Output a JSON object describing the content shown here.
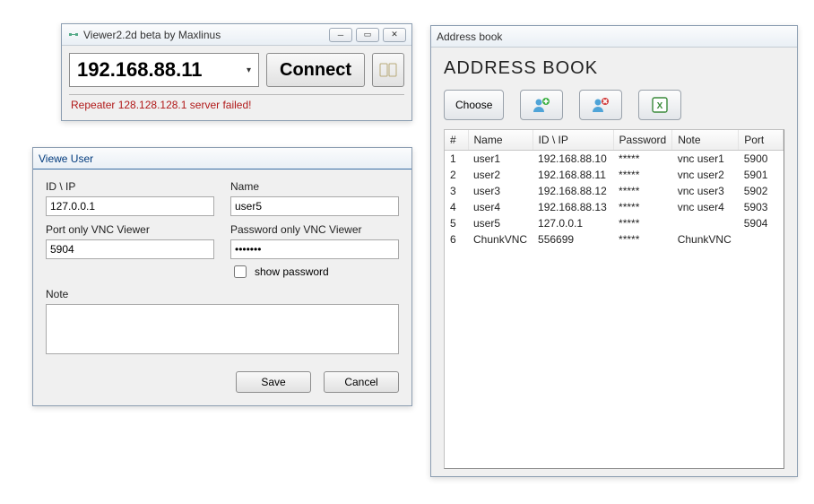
{
  "viewer": {
    "title": "Viewer2.2d beta by Maxlinus",
    "ip_value": "192.168.88.11",
    "connect_label": "Connect",
    "status": "Repeater 128.128.128.1 server failed!"
  },
  "user_form": {
    "title": "Viewe User",
    "labels": {
      "id_ip": "ID \\ IP",
      "name": "Name",
      "port": "Port only VNC Viewer",
      "password": "Password only VNC Viewer",
      "show_password": "show password",
      "note": "Note"
    },
    "values": {
      "id_ip": "127.0.0.1",
      "name": "user5",
      "port": "5904",
      "password": "•••••••",
      "note": ""
    },
    "buttons": {
      "save": "Save",
      "cancel": "Cancel"
    }
  },
  "book": {
    "title_small": "Address book",
    "title_big": "ADDRESS BOOK",
    "choose_label": "Choose",
    "columns": [
      "#",
      "Name",
      "ID \\ IP",
      "Password",
      "Note",
      "Port"
    ],
    "rows": [
      [
        "1",
        "user1",
        "192.168.88.10",
        "*****",
        "vnc user1",
        "5900"
      ],
      [
        "2",
        "user2",
        "192.168.88.11",
        "*****",
        "vnc user2",
        "5901"
      ],
      [
        "3",
        "user3",
        "192.168.88.12",
        "*****",
        "vnc user3",
        "5902"
      ],
      [
        "4",
        "user4",
        "192.168.88.13",
        "*****",
        "vnc user4",
        "5903"
      ],
      [
        "5",
        "user5",
        "127.0.0.1",
        "*****",
        "",
        "5904"
      ],
      [
        "6",
        "ChunkVNC",
        "556699",
        "*****",
        "ChunkVNC",
        ""
      ]
    ]
  }
}
